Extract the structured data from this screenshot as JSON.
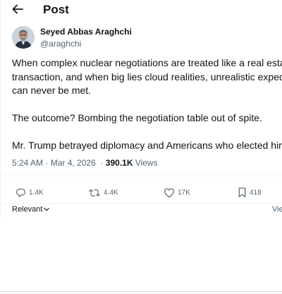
{
  "header": {
    "back_icon": "arrow-left-icon",
    "title": "Post"
  },
  "author": {
    "name": "Seyed Abbas Araghchi",
    "handle": "@araghchi",
    "avatar": "avatar-photo"
  },
  "post": {
    "paragraph1_lines": [
      "When complex nuclear negotiations are treated like a real estat",
      "transaction, and when big lies cloud realities, unrealistic expect",
      "can never be met."
    ],
    "paragraph2": "The outcome? Bombing the negotiation table out of spite.",
    "paragraph3": "Mr. Trump betrayed diplomacy and Americans who elected him"
  },
  "meta": {
    "time": "5:24 AM",
    "separator": "·",
    "date": "Mar 4, 2026",
    "views_count": "390.1K",
    "views_label": "Views"
  },
  "actions": {
    "replies": "1.4K",
    "reposts": "4.4K",
    "likes": "17K",
    "bookmarks": "418",
    "icons": [
      "reply-icon",
      "repost-icon",
      "like-icon",
      "bookmark-icon"
    ]
  },
  "sort": {
    "label": "Relevant",
    "chevron_icon": "chevron-down-icon",
    "view_link": "Vie"
  },
  "colors": {
    "text": "#0f1419",
    "secondary": "#536471",
    "divider": "#eff3f4"
  }
}
